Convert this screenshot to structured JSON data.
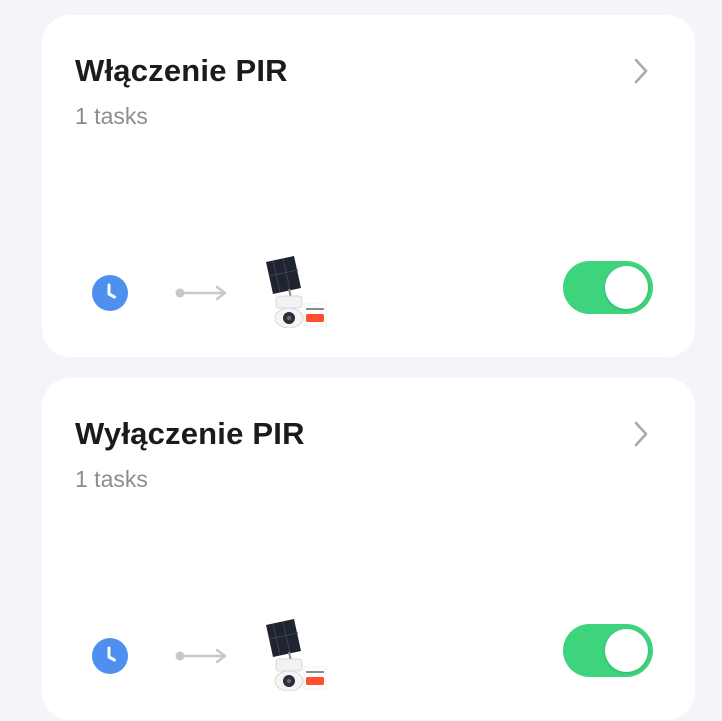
{
  "scenes": [
    {
      "title": "Włączenie PIR",
      "subtitle": "1 tasks",
      "enabled": true,
      "trigger_icon": "clock-icon",
      "action_icon": "solar-camera-device-icon",
      "device_badge": "tuya"
    },
    {
      "title": "Wyłączenie PIR",
      "subtitle": "1 tasks",
      "enabled": true,
      "trigger_icon": "clock-icon",
      "action_icon": "solar-camera-device-icon",
      "device_badge": "tuya"
    }
  ],
  "colors": {
    "background": "#f4f5f8",
    "card": "#ffffff",
    "title": "#1b1b1b",
    "subtitle": "#8d8d8d",
    "toggle_on": "#3ed47e",
    "clock_blue": "#4f8ff0",
    "arrow_gray": "#c8c8c8",
    "chevron_gray": "#a9a9a9"
  }
}
